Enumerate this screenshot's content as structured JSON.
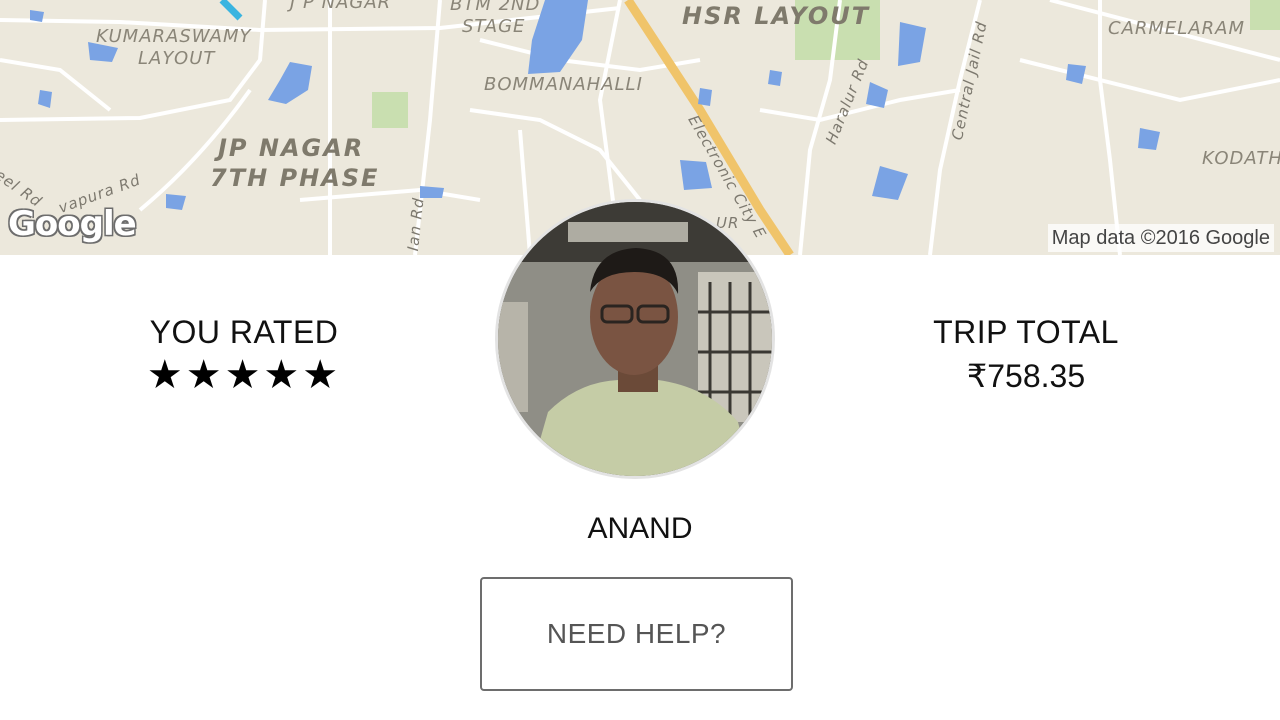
{
  "map": {
    "labels": {
      "kumaraswamy": "KUMARASWAMY",
      "layout": "LAYOUT",
      "jp_nagar_top": "J P NAGAR",
      "btm": "BTM 2ND",
      "stage": "STAGE",
      "hsr": "HSR LAYOUT",
      "carmelaram": "CARMELARAM",
      "bommanahalli": "BOMMANAHALLI",
      "jp_nagar": "JP NAGAR",
      "seventh_phase": "7TH PHASE",
      "kodath": "KODATH",
      "feel_rd": "Feel Rd",
      "vapura_rd": "vapura Rd",
      "electronic_city": "Electronic City E",
      "haralur_rd": "Haralur Rd",
      "central_jail_rd": "Central Jail Rd",
      "ian_rd": "Ian Rd",
      "ur": "UR"
    },
    "logo": "Google",
    "attribution": "Map data ©2016 Google"
  },
  "rating": {
    "title": "YOU RATED",
    "stars": "★★★★★",
    "value": 5,
    "max": 5
  },
  "trip": {
    "title": "TRIP TOTAL",
    "total": "₹758.35"
  },
  "driver": {
    "name": "ANAND"
  },
  "help_button": {
    "label": "NEED HELP?"
  },
  "colors": {
    "map_background": "#ece8dc",
    "water": "#7aa3e4",
    "park": "#c9dfb0",
    "highway": "#f0c46a"
  }
}
